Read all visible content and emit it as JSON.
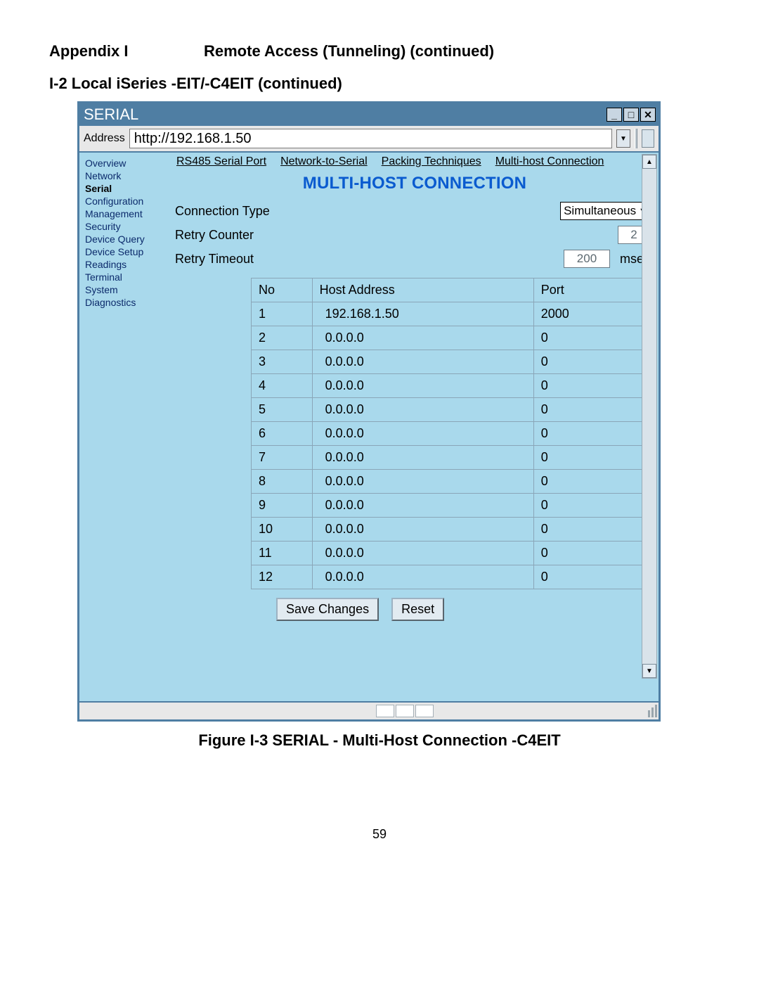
{
  "appendix": {
    "label_left": "Appendix  I",
    "label_right": "Remote Access (Tunneling) (continued)"
  },
  "section_heading": "I-2  Local iSeries -EIT/-C4EIT (continued)",
  "figure_caption": "Figure I-3  SERIAL - Multi-Host Connection -C4EIT",
  "page_number": "59",
  "window": {
    "title": "SERIAL",
    "controls": {
      "min": "_",
      "max": "□",
      "close": "✕"
    },
    "address_label": "Address",
    "address_value": "http://192.168.1.50"
  },
  "sidebar": {
    "items": [
      "Overview",
      "Network",
      "Serial",
      "Configuration",
      "Management",
      "Security",
      "Device Query",
      "Device Setup",
      "Readings",
      "Terminal",
      "System",
      "Diagnostics"
    ],
    "active_index": 2
  },
  "tabs": {
    "items": [
      "RS485 Serial Port",
      "Network-to-Serial",
      "Packing Techniques",
      "Multi-host Connection"
    ],
    "active_index": 3
  },
  "panel_title": "MULTI-HOST CONNECTION",
  "fields": {
    "conn_label": "Connection Type",
    "conn_value": "Simultaneous",
    "retry_counter_label": "Retry Counter",
    "retry_counter_value": "2",
    "retry_timeout_label": "Retry Timeout",
    "retry_timeout_value": "200",
    "retry_timeout_unit": "msec"
  },
  "host_table": {
    "headers": {
      "no": "No",
      "addr": "Host Address",
      "port": "Port"
    },
    "rows": [
      {
        "no": "1",
        "addr": "192.168.1.50",
        "port": "2000"
      },
      {
        "no": "2",
        "addr": "0.0.0.0",
        "port": "0"
      },
      {
        "no": "3",
        "addr": "0.0.0.0",
        "port": "0"
      },
      {
        "no": "4",
        "addr": "0.0.0.0",
        "port": "0"
      },
      {
        "no": "5",
        "addr": "0.0.0.0",
        "port": "0"
      },
      {
        "no": "6",
        "addr": "0.0.0.0",
        "port": "0"
      },
      {
        "no": "7",
        "addr": "0.0.0.0",
        "port": "0"
      },
      {
        "no": "8",
        "addr": "0.0.0.0",
        "port": "0"
      },
      {
        "no": "9",
        "addr": "0.0.0.0",
        "port": "0"
      },
      {
        "no": "10",
        "addr": "0.0.0.0",
        "port": "0"
      },
      {
        "no": "11",
        "addr": "0.0.0.0",
        "port": "0"
      },
      {
        "no": "12",
        "addr": "0.0.0.0",
        "port": "0"
      }
    ]
  },
  "buttons": {
    "save": "Save Changes",
    "reset": "Reset"
  }
}
